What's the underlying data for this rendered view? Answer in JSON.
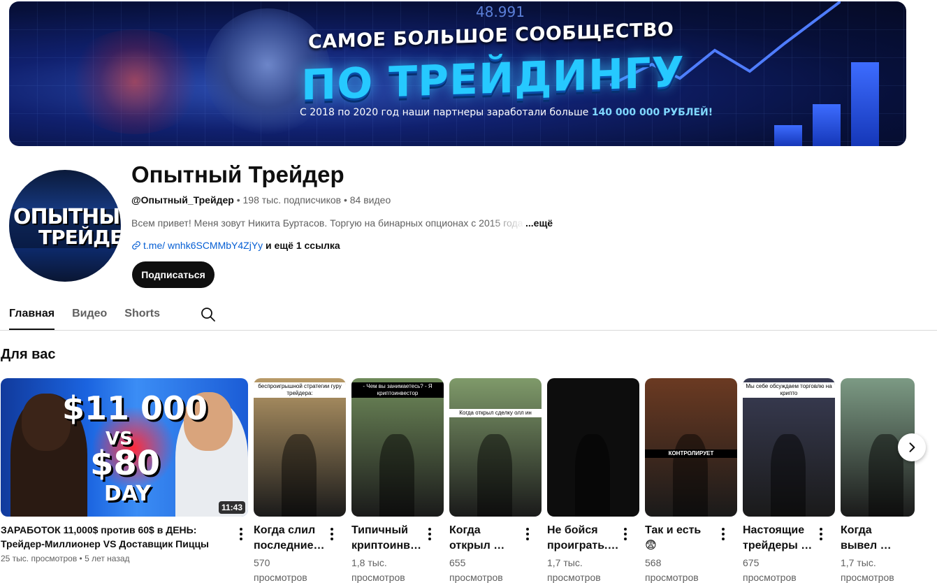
{
  "banner": {
    "top_number": "48.991",
    "line1": "САМОЕ БОЛЬШОЕ СООБЩЕСТВО",
    "line2": "ПО ТРЕЙДИНГУ",
    "line3_prefix": "С 2018 по 2020 год наши партнеры заработали больше",
    "line3_highlight": "140 000 000 РУБЛЕЙ!"
  },
  "channel": {
    "avatar_line1": "ОПЫТНЫЙ",
    "avatar_line2": "ТРЕЙДЕР",
    "title": "Опытный Трейдер",
    "handle": "@Опытный_Трейдер",
    "stats": " • 198 тыс. подписчиков • 84 видео",
    "description": "Всем привет! Меня зовут Никита Буртасов. Торгую на бинарных опционах с 2015 года",
    "more": "...ещё",
    "link_text": "t.me/ wnhk6SCMMbY4ZjYy",
    "link_rest": " и ещё 1 ссылка",
    "subscribe_label": "Подписаться"
  },
  "tabs": [
    {
      "label": "Главная",
      "active": true
    },
    {
      "label": "Видео",
      "active": false
    },
    {
      "label": "Shorts",
      "active": false
    }
  ],
  "section_title": "Для вас",
  "main_video": {
    "thumb_text": [
      "$11 000",
      "VS",
      "$80",
      "DAY"
    ],
    "duration": "11:43",
    "title": "ЗАРАБОТОК 11,000$ против 60$ в ДЕНЬ: Трейдер-Миллионер VS Доставщик Пиццы",
    "sub": "25 тыс. просмотров • 5 лет назад"
  },
  "shorts": [
    {
      "title": "Когда слил последние…",
      "views": "570 просмотров",
      "caption": "беспроигрышной стратегии гуру трейдера:",
      "accent": "#b89a68"
    },
    {
      "title": "Типичный криптоинв…",
      "views": "1,8 тыс. просмотров",
      "caption": "- Чем вы занимаетесь? - Я криптоинвестор",
      "accent": "#6f8a5a"
    },
    {
      "title": "Когда открыл …",
      "views": "655 просмотров",
      "caption": "Когда открыл сделку олл ин",
      "accent": "#7f9a6a"
    },
    {
      "title": "Не бойся проиграть.…",
      "views": "1,7 тыс. просмотров",
      "caption": "",
      "accent": "#151515"
    },
    {
      "title": "Так и есть 😨",
      "views": "568 просмотров",
      "caption": "КОНТРОЛИРУЕТ",
      "accent": "#6b3a22"
    },
    {
      "title": "Настоящие трейдеры …",
      "views": "675 просмотров",
      "caption": "Мы себе обсуждаем торговлю на крипто",
      "accent": "#3a3d55"
    },
    {
      "title": "Когда вывел …",
      "views": "1,7 тыс. просмотров",
      "caption": "",
      "accent": "#7c9a84"
    }
  ]
}
